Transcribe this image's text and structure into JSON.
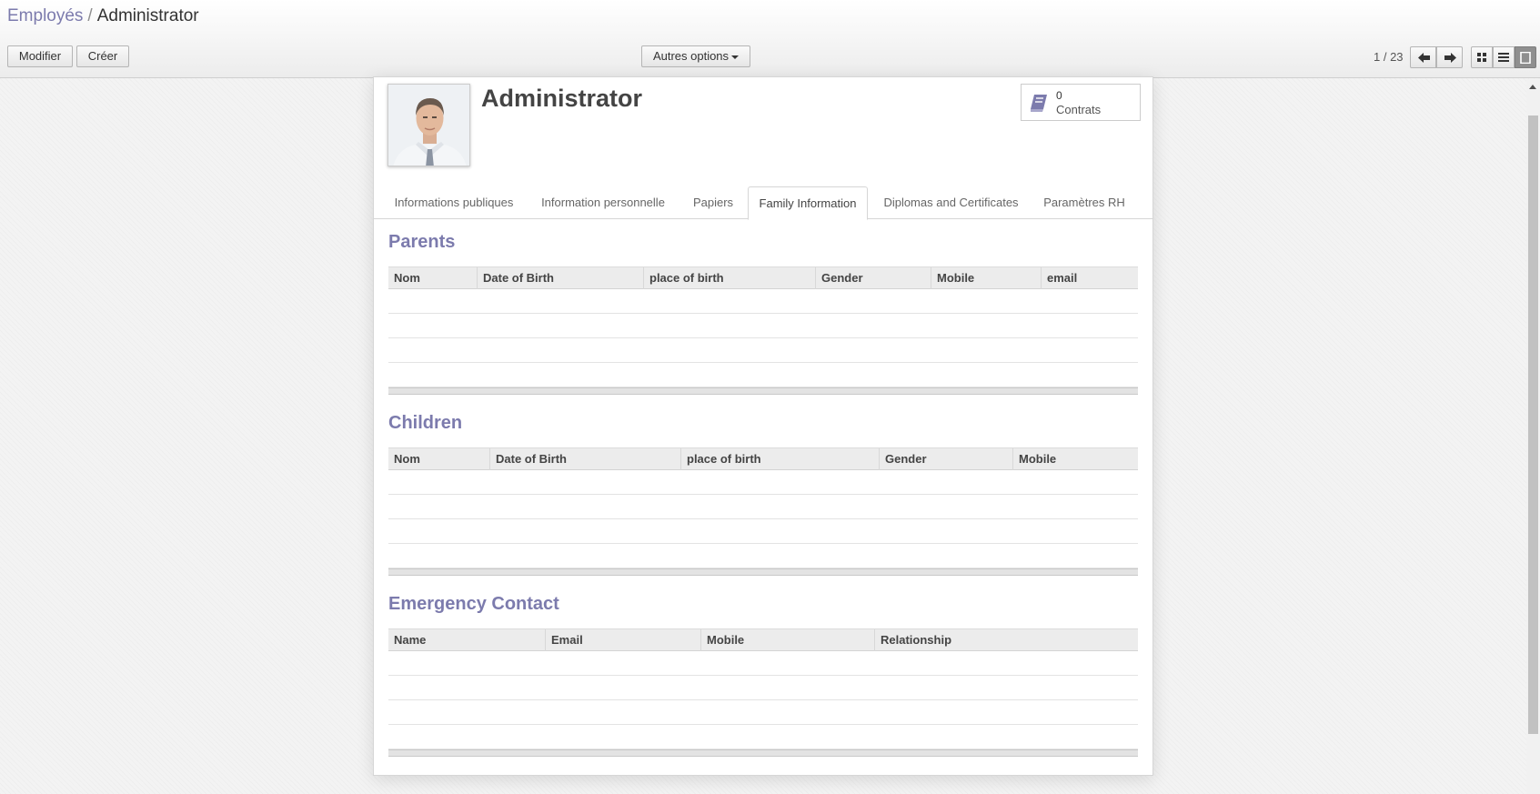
{
  "breadcrumb": {
    "parent": "Employés",
    "separator": "/",
    "current": "Administrator"
  },
  "toolbar": {
    "edit_label": "Modifier",
    "create_label": "Créer",
    "options_label": "Autres options"
  },
  "pager": {
    "value": "1 / 23"
  },
  "views": [
    "kanban-view-icon",
    "list-view-icon",
    "form-view-icon"
  ],
  "employee": {
    "name": "Administrator"
  },
  "stat_button": {
    "value": "0",
    "label": "Contrats",
    "icon": "book-icon"
  },
  "tabs": [
    {
      "label": "Informations publiques"
    },
    {
      "label": "Information personnelle"
    },
    {
      "label": "Papiers"
    },
    {
      "label": "Family Information",
      "active": true
    },
    {
      "label": "Diplomas and Certificates"
    },
    {
      "label": "Paramètres RH"
    }
  ],
  "sections": {
    "parents": {
      "title": "Parents",
      "columns": [
        "Nom",
        "Date of Birth",
        "place of birth",
        "Gender",
        "Mobile",
        "email"
      ]
    },
    "children": {
      "title": "Children",
      "columns": [
        "Nom",
        "Date of Birth",
        "place of birth",
        "Gender",
        "Mobile"
      ]
    },
    "emergency": {
      "title": "Emergency Contact",
      "columns": [
        "Name",
        "Email",
        "Mobile",
        "Relationship"
      ]
    }
  },
  "colors": {
    "accent": "#7c7bad",
    "text": "#4c4c4c",
    "header_bg": "#ececec"
  }
}
